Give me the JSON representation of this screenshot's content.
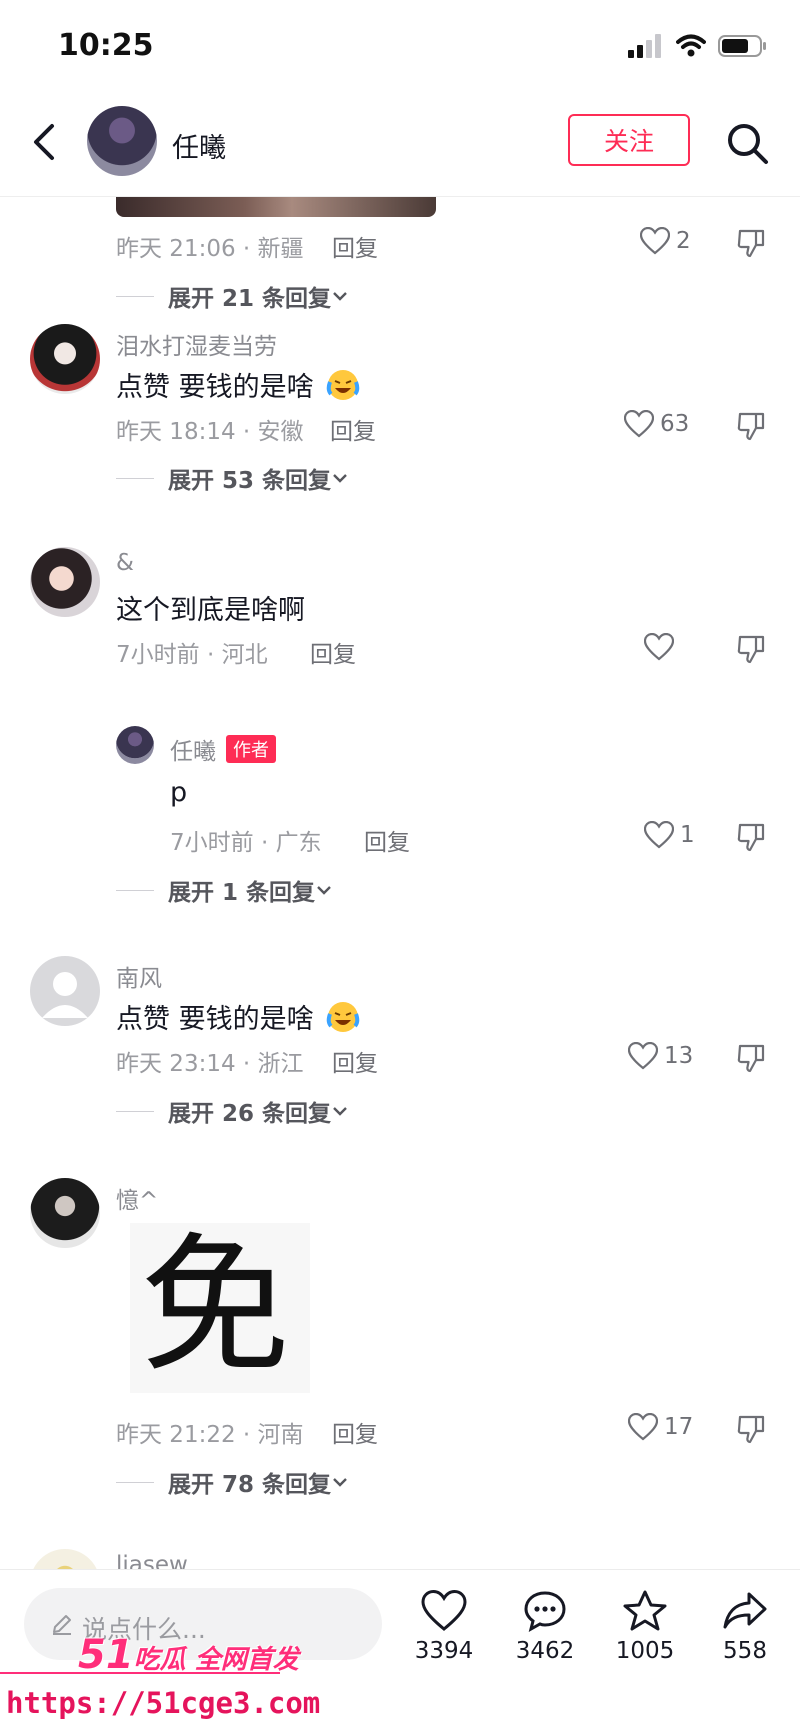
{
  "status": {
    "time": "10:25"
  },
  "header": {
    "name": "任曦",
    "follow_label": "关注"
  },
  "comments": [
    {
      "meta": "昨天 21:06 · 新疆",
      "reply": "回复",
      "likes": "2",
      "expand": "展开 21 条回复"
    },
    {
      "user": "泪水打湿麦当劳",
      "text": "点赞 要钱的是啥",
      "meta": "昨天 18:14 · 安徽",
      "reply": "回复",
      "likes": "63",
      "expand": "展开 53 条回复"
    },
    {
      "user": "&",
      "text": "这个到底是啥啊",
      "meta": "7小时前 · 河北",
      "reply": "回复",
      "likes": "",
      "sub": {
        "user": "任曦",
        "badge": "作者",
        "text": "p",
        "meta": "7小时前 · 广东",
        "reply": "回复",
        "likes": "1"
      },
      "expand": "展开 1 条回复"
    },
    {
      "user": "南风",
      "text": "点赞 要钱的是啥",
      "meta": "昨天 23:14 · 浙江",
      "reply": "回复",
      "likes": "13",
      "expand": "展开 26 条回复"
    },
    {
      "user": "憶^",
      "sticker": "免",
      "meta": "昨天 21:22 · 河南",
      "reply": "回复",
      "likes": "17",
      "expand": "展开 78 条回复"
    },
    {
      "user": "liasew"
    }
  ],
  "bottom": {
    "placeholder": "说点什么...",
    "likes": "3394",
    "comments": "3462",
    "favorites": "1005",
    "shares": "558"
  },
  "watermark": {
    "line1_big": "51",
    "line1_rest": "吃瓜 全网首发",
    "line2": "https://51cge3.com"
  },
  "colors": {
    "accent": "#fe2c55"
  }
}
